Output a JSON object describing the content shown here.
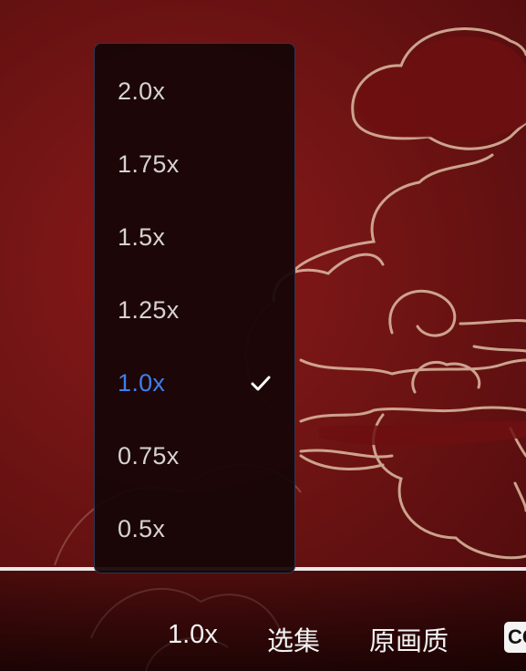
{
  "player": {
    "progress_fraction": 1.0,
    "speed_menu": {
      "options": [
        {
          "label": "2.0x",
          "selected": false
        },
        {
          "label": "1.75x",
          "selected": false
        },
        {
          "label": "1.5x",
          "selected": false
        },
        {
          "label": "1.25x",
          "selected": false
        },
        {
          "label": "1.0x",
          "selected": true
        },
        {
          "label": "0.75x",
          "selected": false
        },
        {
          "label": "0.5x",
          "selected": false
        }
      ],
      "check_icon": "check-icon"
    },
    "controls": {
      "speed_label": "1.0x",
      "episodes_label": "选集",
      "quality_label": "原画质",
      "subtitle_label": "CC"
    },
    "colors": {
      "selected_accent": "#3f7ef0",
      "background": "#741515",
      "cloud_outline": "#d8b39b"
    }
  }
}
